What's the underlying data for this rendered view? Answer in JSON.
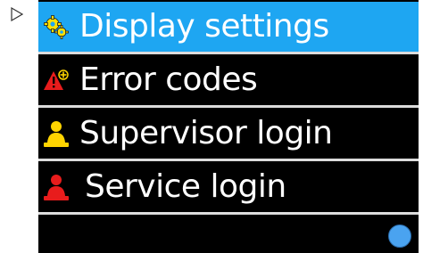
{
  "menu": {
    "items": [
      {
        "label": "Display settings",
        "icon": "gears-icon",
        "selected": true
      },
      {
        "label": "Error codes",
        "icon": "warning-icon",
        "selected": false
      },
      {
        "label": "Supervisor login",
        "icon": "supervisor-user-icon",
        "selected": false
      },
      {
        "label": "Service login",
        "icon": "service-user-icon",
        "selected": false
      }
    ]
  },
  "colors": {
    "selected_background": "#1ea6f2",
    "screen_background": "#000000",
    "separator": "#dcdcdc",
    "supervisor_icon": "#ffd400",
    "service_icon": "#e81c1c",
    "status_dot": "#4aa3f0"
  },
  "status_indicator": {
    "icon": "status-dot-icon"
  }
}
